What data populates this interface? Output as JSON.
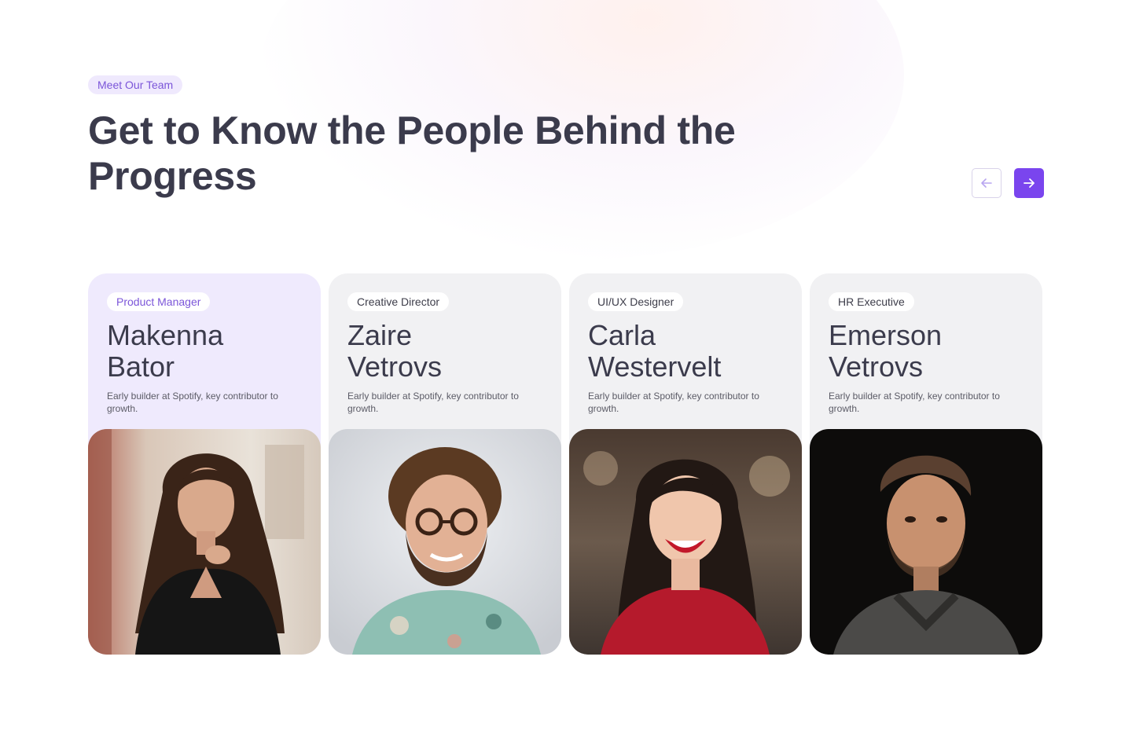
{
  "section": {
    "eyebrow": "Meet Our Team",
    "headline": "Get to Know the People Behind the Progress"
  },
  "nav": {
    "prev_icon": "arrow-left-icon",
    "next_icon": "arrow-right-icon"
  },
  "colors": {
    "accent": "#7a45ee",
    "accent_soft": "#efe9fd",
    "card_bg": "#f1f1f3",
    "card_active_bg": "#efeafd",
    "heading": "#3b3b4c"
  },
  "team": [
    {
      "role": "Product Manager",
      "first": "Makenna",
      "last": "Bator",
      "bio": "Early builder at Spotify, key contributor to growth.",
      "active": true
    },
    {
      "role": "Creative Director",
      "first": "Zaire",
      "last": "Vetrovs",
      "bio": "Early builder at Spotify, key contributor to growth.",
      "active": false
    },
    {
      "role": "UI/UX Designer",
      "first": "Carla",
      "last": "Westervelt",
      "bio": "Early builder at Spotify, key contributor to growth.",
      "active": false
    },
    {
      "role": "HR Executive",
      "first": "Emerson",
      "last": "Vetrovs",
      "bio": "Early builder at Spotify, key contributor to growth.",
      "active": false
    }
  ]
}
